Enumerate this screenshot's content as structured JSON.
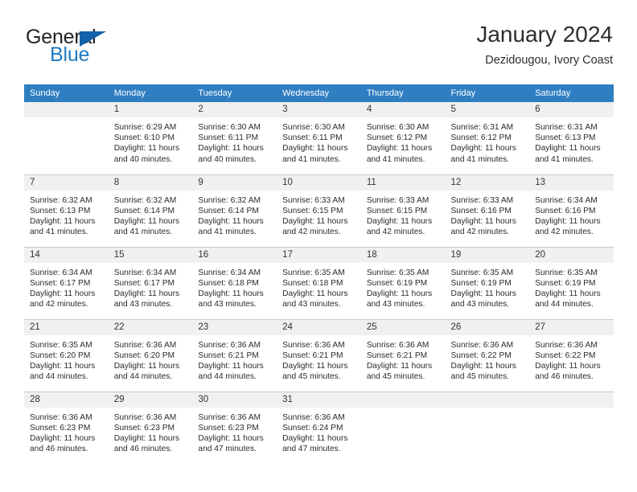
{
  "brand": {
    "name_part1": "General",
    "name_part2": "Blue",
    "logo_icon": "triangle-logo-icon",
    "accent_color": "#1361a8"
  },
  "header": {
    "title": "January 2024",
    "subtitle": "Dezidougou, Ivory Coast"
  },
  "colors": {
    "header_row": "#2f7ec1",
    "daynum_band": "#f0f0f0",
    "grid_line": "#c8c8c8",
    "text": "#2b2b2b"
  },
  "weekday_headers": [
    "Sunday",
    "Monday",
    "Tuesday",
    "Wednesday",
    "Thursday",
    "Friday",
    "Saturday"
  ],
  "weeks": [
    [
      {
        "day": "",
        "empty": true,
        "sunrise": "",
        "sunset": "",
        "daylight_line1": "",
        "daylight_line2": ""
      },
      {
        "day": "1",
        "sunrise": "Sunrise: 6:29 AM",
        "sunset": "Sunset: 6:10 PM",
        "daylight_line1": "Daylight: 11 hours",
        "daylight_line2": "and 40 minutes."
      },
      {
        "day": "2",
        "sunrise": "Sunrise: 6:30 AM",
        "sunset": "Sunset: 6:11 PM",
        "daylight_line1": "Daylight: 11 hours",
        "daylight_line2": "and 40 minutes."
      },
      {
        "day": "3",
        "sunrise": "Sunrise: 6:30 AM",
        "sunset": "Sunset: 6:11 PM",
        "daylight_line1": "Daylight: 11 hours",
        "daylight_line2": "and 41 minutes."
      },
      {
        "day": "4",
        "sunrise": "Sunrise: 6:30 AM",
        "sunset": "Sunset: 6:12 PM",
        "daylight_line1": "Daylight: 11 hours",
        "daylight_line2": "and 41 minutes."
      },
      {
        "day": "5",
        "sunrise": "Sunrise: 6:31 AM",
        "sunset": "Sunset: 6:12 PM",
        "daylight_line1": "Daylight: 11 hours",
        "daylight_line2": "and 41 minutes."
      },
      {
        "day": "6",
        "sunrise": "Sunrise: 6:31 AM",
        "sunset": "Sunset: 6:13 PM",
        "daylight_line1": "Daylight: 11 hours",
        "daylight_line2": "and 41 minutes."
      }
    ],
    [
      {
        "day": "7",
        "sunrise": "Sunrise: 6:32 AM",
        "sunset": "Sunset: 6:13 PM",
        "daylight_line1": "Daylight: 11 hours",
        "daylight_line2": "and 41 minutes."
      },
      {
        "day": "8",
        "sunrise": "Sunrise: 6:32 AM",
        "sunset": "Sunset: 6:14 PM",
        "daylight_line1": "Daylight: 11 hours",
        "daylight_line2": "and 41 minutes."
      },
      {
        "day": "9",
        "sunrise": "Sunrise: 6:32 AM",
        "sunset": "Sunset: 6:14 PM",
        "daylight_line1": "Daylight: 11 hours",
        "daylight_line2": "and 41 minutes."
      },
      {
        "day": "10",
        "sunrise": "Sunrise: 6:33 AM",
        "sunset": "Sunset: 6:15 PM",
        "daylight_line1": "Daylight: 11 hours",
        "daylight_line2": "and 42 minutes."
      },
      {
        "day": "11",
        "sunrise": "Sunrise: 6:33 AM",
        "sunset": "Sunset: 6:15 PM",
        "daylight_line1": "Daylight: 11 hours",
        "daylight_line2": "and 42 minutes."
      },
      {
        "day": "12",
        "sunrise": "Sunrise: 6:33 AM",
        "sunset": "Sunset: 6:16 PM",
        "daylight_line1": "Daylight: 11 hours",
        "daylight_line2": "and 42 minutes."
      },
      {
        "day": "13",
        "sunrise": "Sunrise: 6:34 AM",
        "sunset": "Sunset: 6:16 PM",
        "daylight_line1": "Daylight: 11 hours",
        "daylight_line2": "and 42 minutes."
      }
    ],
    [
      {
        "day": "14",
        "sunrise": "Sunrise: 6:34 AM",
        "sunset": "Sunset: 6:17 PM",
        "daylight_line1": "Daylight: 11 hours",
        "daylight_line2": "and 42 minutes."
      },
      {
        "day": "15",
        "sunrise": "Sunrise: 6:34 AM",
        "sunset": "Sunset: 6:17 PM",
        "daylight_line1": "Daylight: 11 hours",
        "daylight_line2": "and 43 minutes."
      },
      {
        "day": "16",
        "sunrise": "Sunrise: 6:34 AM",
        "sunset": "Sunset: 6:18 PM",
        "daylight_line1": "Daylight: 11 hours",
        "daylight_line2": "and 43 minutes."
      },
      {
        "day": "17",
        "sunrise": "Sunrise: 6:35 AM",
        "sunset": "Sunset: 6:18 PM",
        "daylight_line1": "Daylight: 11 hours",
        "daylight_line2": "and 43 minutes."
      },
      {
        "day": "18",
        "sunrise": "Sunrise: 6:35 AM",
        "sunset": "Sunset: 6:19 PM",
        "daylight_line1": "Daylight: 11 hours",
        "daylight_line2": "and 43 minutes."
      },
      {
        "day": "19",
        "sunrise": "Sunrise: 6:35 AM",
        "sunset": "Sunset: 6:19 PM",
        "daylight_line1": "Daylight: 11 hours",
        "daylight_line2": "and 43 minutes."
      },
      {
        "day": "20",
        "sunrise": "Sunrise: 6:35 AM",
        "sunset": "Sunset: 6:19 PM",
        "daylight_line1": "Daylight: 11 hours",
        "daylight_line2": "and 44 minutes."
      }
    ],
    [
      {
        "day": "21",
        "sunrise": "Sunrise: 6:35 AM",
        "sunset": "Sunset: 6:20 PM",
        "daylight_line1": "Daylight: 11 hours",
        "daylight_line2": "and 44 minutes."
      },
      {
        "day": "22",
        "sunrise": "Sunrise: 6:36 AM",
        "sunset": "Sunset: 6:20 PM",
        "daylight_line1": "Daylight: 11 hours",
        "daylight_line2": "and 44 minutes."
      },
      {
        "day": "23",
        "sunrise": "Sunrise: 6:36 AM",
        "sunset": "Sunset: 6:21 PM",
        "daylight_line1": "Daylight: 11 hours",
        "daylight_line2": "and 44 minutes."
      },
      {
        "day": "24",
        "sunrise": "Sunrise: 6:36 AM",
        "sunset": "Sunset: 6:21 PM",
        "daylight_line1": "Daylight: 11 hours",
        "daylight_line2": "and 45 minutes."
      },
      {
        "day": "25",
        "sunrise": "Sunrise: 6:36 AM",
        "sunset": "Sunset: 6:21 PM",
        "daylight_line1": "Daylight: 11 hours",
        "daylight_line2": "and 45 minutes."
      },
      {
        "day": "26",
        "sunrise": "Sunrise: 6:36 AM",
        "sunset": "Sunset: 6:22 PM",
        "daylight_line1": "Daylight: 11 hours",
        "daylight_line2": "and 45 minutes."
      },
      {
        "day": "27",
        "sunrise": "Sunrise: 6:36 AM",
        "sunset": "Sunset: 6:22 PM",
        "daylight_line1": "Daylight: 11 hours",
        "daylight_line2": "and 46 minutes."
      }
    ],
    [
      {
        "day": "28",
        "sunrise": "Sunrise: 6:36 AM",
        "sunset": "Sunset: 6:23 PM",
        "daylight_line1": "Daylight: 11 hours",
        "daylight_line2": "and 46 minutes."
      },
      {
        "day": "29",
        "sunrise": "Sunrise: 6:36 AM",
        "sunset": "Sunset: 6:23 PM",
        "daylight_line1": "Daylight: 11 hours",
        "daylight_line2": "and 46 minutes."
      },
      {
        "day": "30",
        "sunrise": "Sunrise: 6:36 AM",
        "sunset": "Sunset: 6:23 PM",
        "daylight_line1": "Daylight: 11 hours",
        "daylight_line2": "and 47 minutes."
      },
      {
        "day": "31",
        "sunrise": "Sunrise: 6:36 AM",
        "sunset": "Sunset: 6:24 PM",
        "daylight_line1": "Daylight: 11 hours",
        "daylight_line2": "and 47 minutes."
      },
      {
        "day": "",
        "empty": true,
        "sunrise": "",
        "sunset": "",
        "daylight_line1": "",
        "daylight_line2": ""
      },
      {
        "day": "",
        "empty": true,
        "sunrise": "",
        "sunset": "",
        "daylight_line1": "",
        "daylight_line2": ""
      },
      {
        "day": "",
        "empty": true,
        "sunrise": "",
        "sunset": "",
        "daylight_line1": "",
        "daylight_line2": ""
      }
    ]
  ]
}
